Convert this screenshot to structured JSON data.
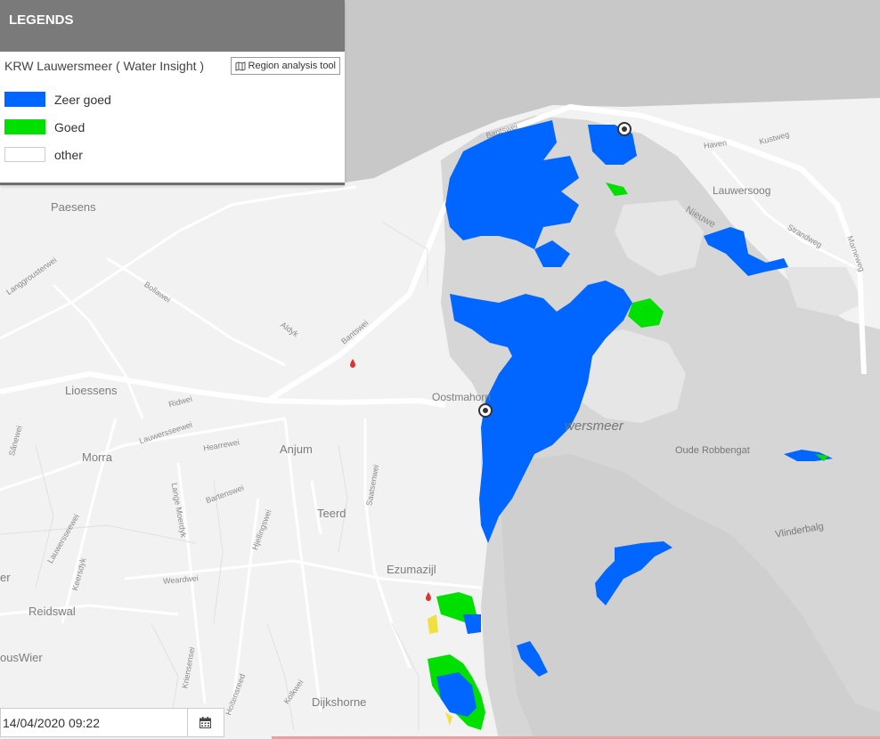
{
  "legend": {
    "header": "LEGENDS",
    "layer_name": "KRW Lauwersmeer ( Water Insight )",
    "region_tool_label": "Region analysis tool",
    "items": [
      {
        "label": "Zeer goed",
        "color": "#0066ff"
      },
      {
        "label": "Goed",
        "color": "#00e000"
      },
      {
        "label": "other",
        "color": "#ffffff"
      }
    ]
  },
  "map": {
    "towns": [
      "Paesens",
      "Lioessens",
      "Morra",
      "Anjum",
      "Oostmahorn",
      "Teerd",
      "Ezumazijl",
      "Reidswal",
      "Dijkshorne",
      "Lauwersoog",
      "ousWier"
    ],
    "roads": [
      "Bantswei",
      "Bollawei",
      "Langgrousterwei",
      "Aldyk",
      "Ridwei",
      "Lauwersseewei",
      "Hearrewei",
      "Bartenswei",
      "Lange Moerdyk",
      "Hjellingswei",
      "Saatsenwei",
      "Weardwei",
      "Lauwersseewei",
      "Keersdyk",
      "Kriensensei",
      "Hoitensreed",
      "Kolkwei",
      "Haven",
      "Kustweg",
      "Nieuwe",
      "Strandweg",
      "Marneweg",
      "Sânewei"
    ],
    "water_labels": [
      "wersmeer",
      "Oude Robbengat",
      "Vlinderbalg"
    ],
    "edge_labels": [
      "er"
    ],
    "colors": {
      "land": "#f2f2f2",
      "sea": "#c8c8c8",
      "lake": "#d4d4d4",
      "very_good": "#0066ff",
      "good": "#00e000"
    }
  },
  "date": {
    "value": "14/04/2020 09:22",
    "calendar_icon": "calendar-icon"
  }
}
